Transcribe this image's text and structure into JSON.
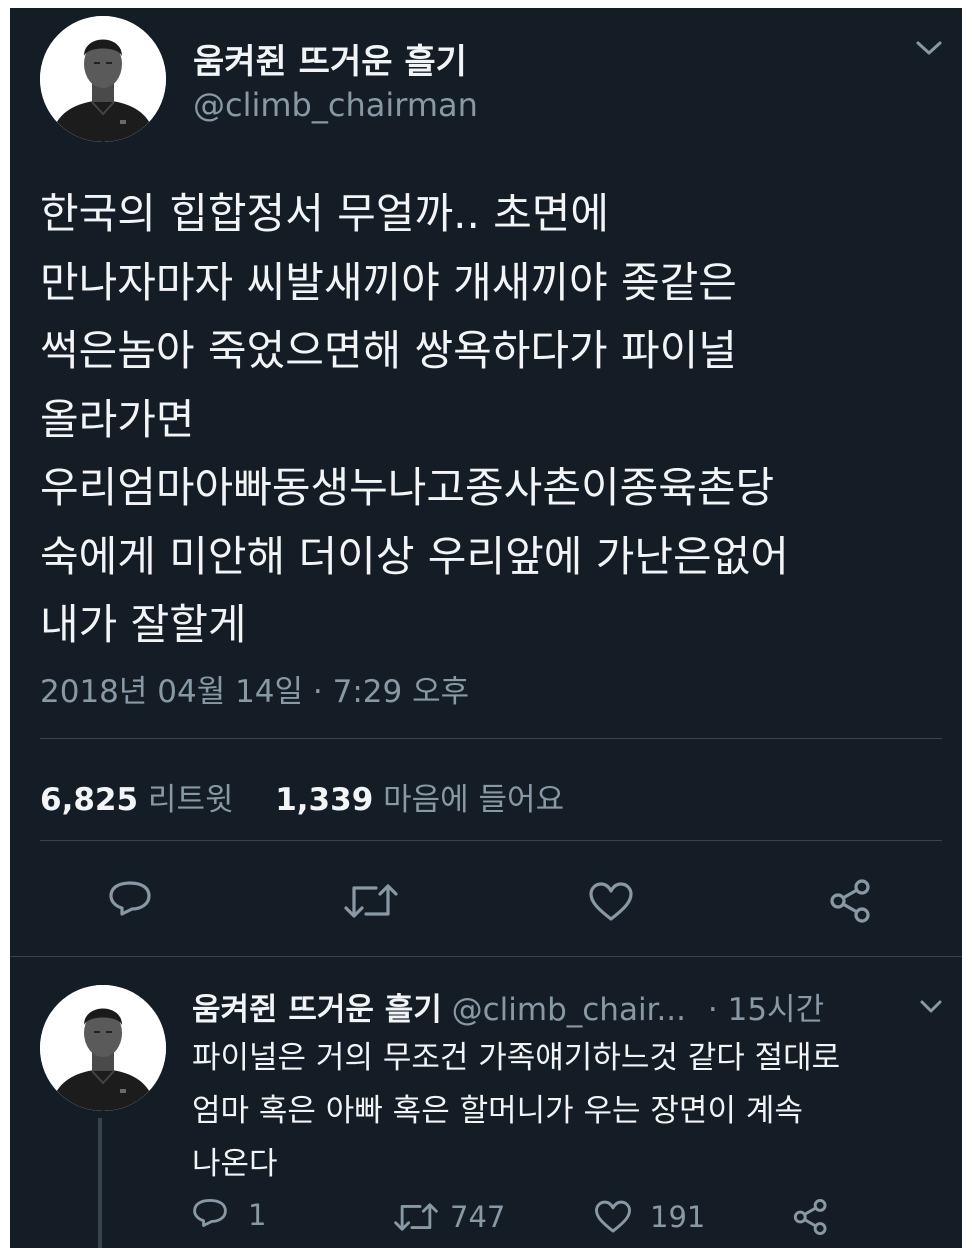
{
  "main_tweet": {
    "display_name": "움켜쥔 뜨거운 흘기",
    "handle": "@climb_chairman",
    "text_lines": [
      "한국의 힙합정서 무얼까.. 초면에",
      "만나자마자 씨발새끼야 개새끼야 좆같은",
      "썩은놈아 죽었으면해 쌍욕하다가 파이널",
      "올라가면",
      "우리엄마아빠동생누나고종사촌이종육촌당",
      "숙에게 미안해 더이상 우리앞에 가난은없어",
      "내가 잘할게"
    ],
    "timestamp": "2018년 04월 14일 · 7:29 오후",
    "retweet_count": "6,825",
    "retweet_label": "리트윗",
    "like_count": "1,339",
    "like_label": "마음에 들어요",
    "icons": {
      "reply": "reply-icon",
      "retweet": "retweet-icon",
      "like": "heart-icon",
      "share": "share-icon",
      "menu": "chevron-down-icon"
    }
  },
  "reply_tweet": {
    "display_name": "움켜쥔 뜨거운 흘기",
    "handle": "@climb_chair...",
    "time_ago": "· 15시간",
    "text_lines": [
      "파이널은 거의 무조건 가족얘기하느것 같다 절대로",
      "엄마 혹은 아빠 혹은 할머니가 우는 장면이 계속",
      "나온다"
    ],
    "reply_count": "1",
    "retweet_count": "747",
    "like_count": "191"
  },
  "colors": {
    "background": "#141d26",
    "primary_text": "#f2f4f6",
    "secondary_text": "#8899a6",
    "divider": "#38444d"
  }
}
